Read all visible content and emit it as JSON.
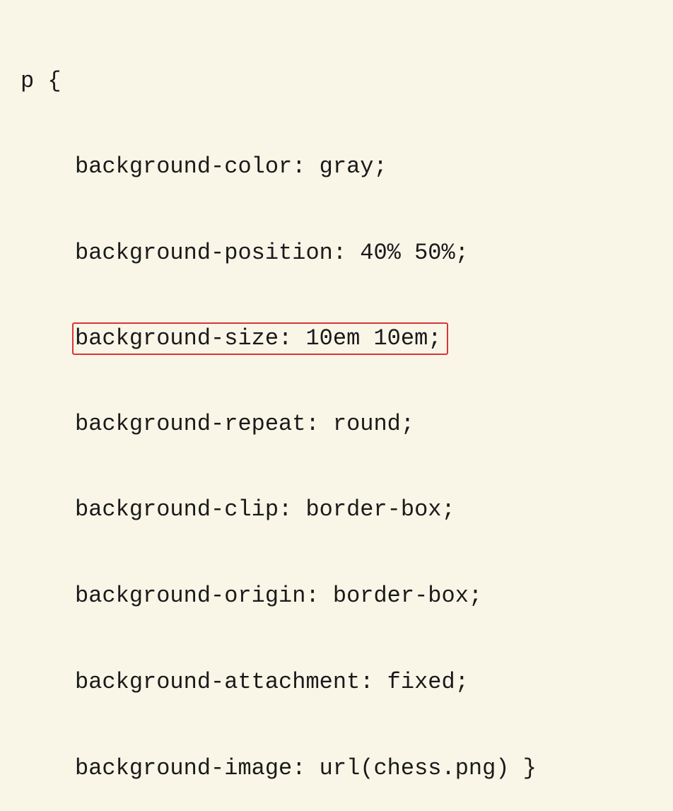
{
  "code": {
    "selector": "p {",
    "lines": [
      "background-color: gray;",
      "background-position: 40% 50%;",
      "background-size: 10em 10em;",
      "background-repeat: round;",
      "background-clip: border-box;",
      "background-origin: border-box;",
      "background-attachment: fixed;",
      "background-image: url(chess.png) }"
    ],
    "highlighted_index": 2
  }
}
